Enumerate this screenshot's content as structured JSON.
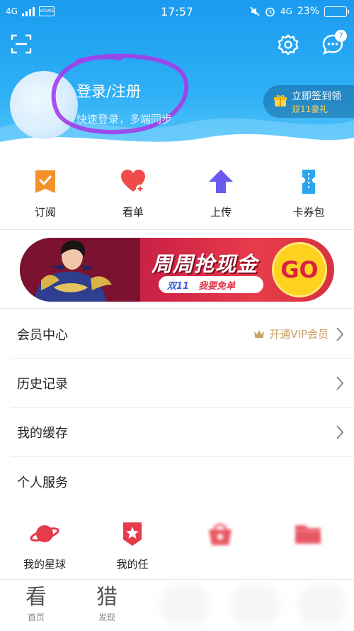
{
  "status_bar": {
    "network": "4G",
    "app_badge": "VOUKE",
    "time": "17:57",
    "right_network": "4G",
    "battery": "23%",
    "battery_level": 0.23
  },
  "header": {
    "login_title": "登录/注册",
    "login_subtitle": "快速登录，多端同步",
    "message_count": "7",
    "signin_line1": "立即签到领",
    "signin_line2": "双11豪礼"
  },
  "quick_actions": [
    {
      "label": "订阅",
      "icon": "subscribe-icon",
      "color": "#f4922a"
    },
    {
      "label": "看单",
      "icon": "watchlist-heart-icon",
      "color": "#f04a4a"
    },
    {
      "label": "上传",
      "icon": "upload-icon",
      "color": "#6a5af0"
    },
    {
      "label": "卡券包",
      "icon": "ticket-icon",
      "color": "#2aa6f0"
    }
  ],
  "banner": {
    "headline": "周周抢现金",
    "pill_left": "双11",
    "pill_right": "我要免单",
    "go": "GO"
  },
  "list": {
    "member_center": "会员中心",
    "vip_label": "开通VIP会员",
    "history": "历史记录",
    "cache": "我的缓存",
    "personal_services": "个人服务"
  },
  "services": [
    {
      "label": "我的星球",
      "icon": "planet-icon"
    },
    {
      "label": "我的任",
      "icon": "badge-icon"
    },
    {
      "label": "",
      "icon": "basket-icon"
    },
    {
      "label": "",
      "icon": "folder-icon"
    }
  ],
  "tabbar": [
    {
      "big": "看",
      "small": "首页"
    },
    {
      "big": "猎",
      "small": "发现"
    }
  ],
  "colors": {
    "header_blue": "#1a9bf0",
    "accent_red": "#e53b4a",
    "vip_gold": "#c8a060"
  }
}
